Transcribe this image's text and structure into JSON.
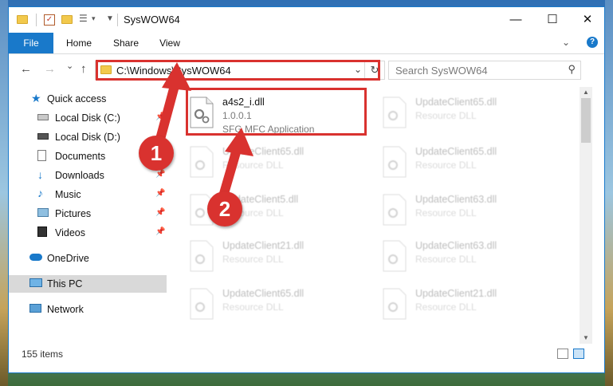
{
  "window": {
    "title": "SysWOW64",
    "minimize_glyph": "—",
    "maximize_glyph": "☐",
    "close_glyph": "✕"
  },
  "ribbon": {
    "tabs": [
      "File",
      "Home",
      "Share",
      "View"
    ],
    "expand_glyph": "⌄",
    "help_glyph": "?"
  },
  "nav": {
    "back_glyph": "←",
    "forward_glyph": "→",
    "recent_glyph": "⌄",
    "up_glyph": "↑",
    "address": "C:\\Windows\\SysWOW64",
    "address_dropdown_glyph": "⌄",
    "refresh_glyph": "↻",
    "search_placeholder": "Search SysWOW64",
    "search_glyph": "⚲"
  },
  "sidebar": {
    "items": [
      {
        "label": "Quick access",
        "icon": "star-icon",
        "pinned": false
      },
      {
        "label": "Local Disk (C:)",
        "icon": "drive-icon",
        "pinned": true
      },
      {
        "label": "Local Disk (D:)",
        "icon": "drive-icon",
        "pinned": false
      },
      {
        "label": "Documents",
        "icon": "documents-icon",
        "pinned": true
      },
      {
        "label": "Downloads",
        "icon": "download-icon",
        "pinned": true
      },
      {
        "label": "Music",
        "icon": "music-icon",
        "pinned": true
      },
      {
        "label": "Pictures",
        "icon": "pictures-icon",
        "pinned": true
      },
      {
        "label": "Videos",
        "icon": "videos-icon",
        "pinned": true
      },
      {
        "label": "OneDrive",
        "icon": "cloud-icon",
        "pinned": false
      },
      {
        "label": "This PC",
        "icon": "computer-icon",
        "pinned": false,
        "selected": true
      },
      {
        "label": "Network",
        "icon": "network-icon",
        "pinned": false
      }
    ],
    "pin_glyph": "📌"
  },
  "files": {
    "highlighted": {
      "name": "a4s2_i.dll",
      "version": "1.0.0.1",
      "description": "SFG MFC Application"
    },
    "others": [
      {
        "name": "UpdateClient65.dll",
        "type": "Resource DLL"
      },
      {
        "name": "UpdateClient65.dll",
        "type": "Resource DLL"
      },
      {
        "name": "UpdateClient65.dll",
        "type": "Resource DLL"
      },
      {
        "name": "UpdateClient5.dll",
        "type": "Resource DLL"
      },
      {
        "name": "UpdateClient63.dll",
        "type": "Resource DLL"
      },
      {
        "name": "UpdateClient21.dll",
        "type": "Resource DLL"
      },
      {
        "name": "UpdateClient63.dll",
        "type": "Resource DLL"
      },
      {
        "name": "UpdateClient65.dll",
        "type": "Resource DLL"
      },
      {
        "name": "UpdateClient21.dll",
        "type": "Resource DLL"
      }
    ]
  },
  "status": {
    "item_count": "155 items"
  },
  "annotations": {
    "step1": "1",
    "step2": "2"
  },
  "colors": {
    "accent": "#1979ca",
    "annotation_red": "#d9322f"
  }
}
